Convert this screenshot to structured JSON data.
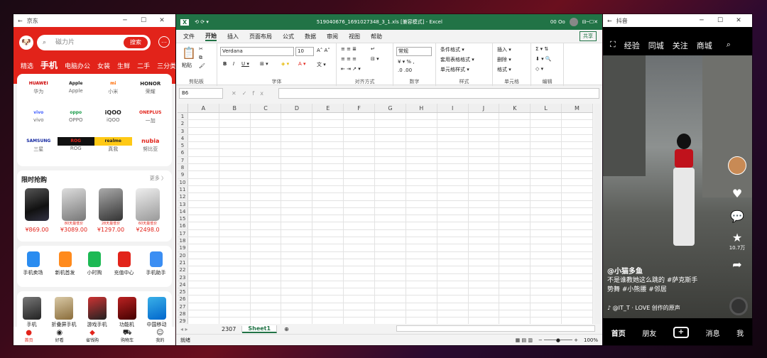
{
  "jd": {
    "window_title": "京东",
    "search_placeholder": "磁力片",
    "search_button": "搜索",
    "categories": [
      "精选",
      "手机",
      "电脑办公",
      "女装",
      "生鲜",
      "二手",
      "三分类"
    ],
    "brands": [
      {
        "logo": "HUAWEI",
        "name": "华为"
      },
      {
        "logo": "Apple",
        "name": "Apple"
      },
      {
        "logo": "mi",
        "name": "小米"
      },
      {
        "logo": "HONOR",
        "name": "荣耀"
      },
      {
        "logo": "vivo",
        "name": "vivo"
      },
      {
        "logo": "oppo",
        "name": "OPPO"
      },
      {
        "logo": "iQOO",
        "name": "iQOO"
      },
      {
        "logo": "ONEPLUS",
        "name": "一加"
      },
      {
        "logo": "SAMSUNG",
        "name": "三星"
      },
      {
        "logo": "ROG",
        "name": "ROG"
      },
      {
        "logo": "realme",
        "name": "真我"
      },
      {
        "logo": "nubia",
        "name": "努比亚"
      }
    ],
    "flash_title": "限时抢购",
    "flash_more": "更多 〉",
    "flash_items": [
      {
        "tag": "",
        "price": "¥869.00"
      },
      {
        "tag": "80天最低价",
        "price": "¥3089.00"
      },
      {
        "tag": "28天最低价",
        "price": "¥1297.00"
      },
      {
        "tag": "60天最低价",
        "price": "¥2498.0"
      }
    ],
    "services": [
      "手机卖场",
      "新机首发",
      "小时购",
      "充值中心",
      "手机助手"
    ],
    "big_products": [
      "手机",
      "折叠屏手机",
      "游戏手机",
      "功能机",
      "中国移动"
    ],
    "tabs": [
      "首页",
      "好看",
      "省钱购",
      "购物车",
      "我的"
    ]
  },
  "excel": {
    "window_title": "519040676_1691027348_3_1.xls [兼容模式] - Excel",
    "user": "00 Oo",
    "menu": [
      "文件",
      "开始",
      "插入",
      "页面布局",
      "公式",
      "数据",
      "审阅",
      "视图",
      "帮助"
    ],
    "share": "共享",
    "clipboard_group": "剪贴板",
    "paste_label": "粘贴",
    "font_name": "Verdana",
    "font_size": "10",
    "font_group": "字体",
    "align_group": "对齐方式",
    "number_format": "常规",
    "number_group": "数字",
    "styles": [
      "条件格式 ▾",
      "套用表格格式 ▾",
      "单元格样式 ▾"
    ],
    "styles_group": "样式",
    "cells": [
      "插入 ▾",
      "删除 ▾",
      "格式 ▾"
    ],
    "cells_group": "单元格",
    "edit_group": "编辑",
    "name_box": "B6",
    "columns": [
      "A",
      "B",
      "C",
      "D",
      "E",
      "F",
      "G",
      "H",
      "I",
      "J",
      "K",
      "L",
      "M"
    ],
    "rows": [
      "1",
      "2",
      "3",
      "4",
      "5",
      "6",
      "7",
      "8",
      "9",
      "10",
      "11",
      "12",
      "13",
      "14",
      "15",
      "16",
      "17",
      "18",
      "19",
      "20",
      "21",
      "22",
      "23",
      "24",
      "25",
      "26",
      "27",
      "28",
      "29"
    ],
    "sheets": [
      "2307",
      "Sheet1"
    ],
    "status_left": "就绪",
    "zoom": "100%"
  },
  "douyin": {
    "window_title": "抖音",
    "top_tabs": [
      "经验",
      "同城",
      "关注",
      "商城"
    ],
    "side_count": "10.7万",
    "author": "@小猫多鱼",
    "caption1": "不是谁教她这么跳的 #萨克斯手",
    "caption2": "势舞 #小熊腰 #邻居",
    "music": "♪ @IT_T · LOVE 创作的原声",
    "bottom_tabs": [
      "首页",
      "朋友",
      "+",
      "消息",
      "我"
    ]
  }
}
